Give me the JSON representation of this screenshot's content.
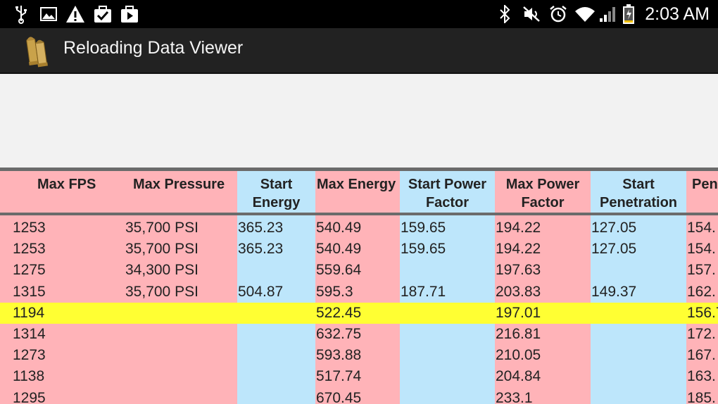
{
  "status_bar": {
    "time": "2:03 AM",
    "left_icons": [
      "usb-icon",
      "image-icon",
      "warning-icon",
      "briefcase-check-icon",
      "play-store-icon"
    ],
    "right_icons": [
      "bluetooth-icon",
      "mute-icon",
      "alarm-icon",
      "wifi-icon",
      "signal-icon",
      "battery-icon"
    ]
  },
  "action_bar": {
    "title": "Reloading Data Viewer"
  },
  "colors": {
    "pink": "#ffb3b8",
    "blue": "#bde6fb",
    "highlight": "#ffff33"
  },
  "table": {
    "columns": [
      {
        "label": "Max FPS",
        "color": "pink"
      },
      {
        "label": "Max Pressure",
        "color": "pink"
      },
      {
        "label": "Start Energy",
        "color": "blue"
      },
      {
        "label": "Max Energy",
        "color": "pink"
      },
      {
        "label": "Start Power Factor",
        "color": "blue"
      },
      {
        "label": "Max Power Factor",
        "color": "pink"
      },
      {
        "label": "Start Penetration",
        "color": "blue"
      },
      {
        "label": "Pen",
        "color": "pink"
      }
    ],
    "rows": [
      {
        "cells": [
          "1253",
          "35,700 PSI",
          "365.23",
          "540.49",
          "159.65",
          "194.22",
          "127.05",
          "154."
        ],
        "highlight": false
      },
      {
        "cells": [
          "1253",
          "35,700 PSI",
          "365.23",
          "540.49",
          "159.65",
          "194.22",
          "127.05",
          "154."
        ],
        "highlight": false
      },
      {
        "cells": [
          "1275",
          "34,300 PSI",
          "",
          "559.64",
          "",
          "197.63",
          "",
          "157."
        ],
        "highlight": false
      },
      {
        "cells": [
          "1315",
          "35,700 PSI",
          "504.87",
          "595.3",
          "187.71",
          "203.83",
          "149.37",
          "162."
        ],
        "highlight": false
      },
      {
        "cells": [
          "1194",
          "",
          "",
          "522.45",
          "",
          "197.01",
          "",
          "156.7"
        ],
        "highlight": true
      },
      {
        "cells": [
          "1314",
          "",
          "",
          "632.75",
          "",
          "216.81",
          "",
          "172."
        ],
        "highlight": false
      },
      {
        "cells": [
          "1273",
          "",
          "",
          "593.88",
          "",
          "210.05",
          "",
          "167."
        ],
        "highlight": false
      },
      {
        "cells": [
          "1138",
          "",
          "",
          "517.74",
          "",
          "204.84",
          "",
          "163."
        ],
        "highlight": false
      },
      {
        "cells": [
          "1295",
          "",
          "",
          "670.45",
          "",
          "233.1",
          "",
          "185."
        ],
        "highlight": false
      }
    ]
  }
}
